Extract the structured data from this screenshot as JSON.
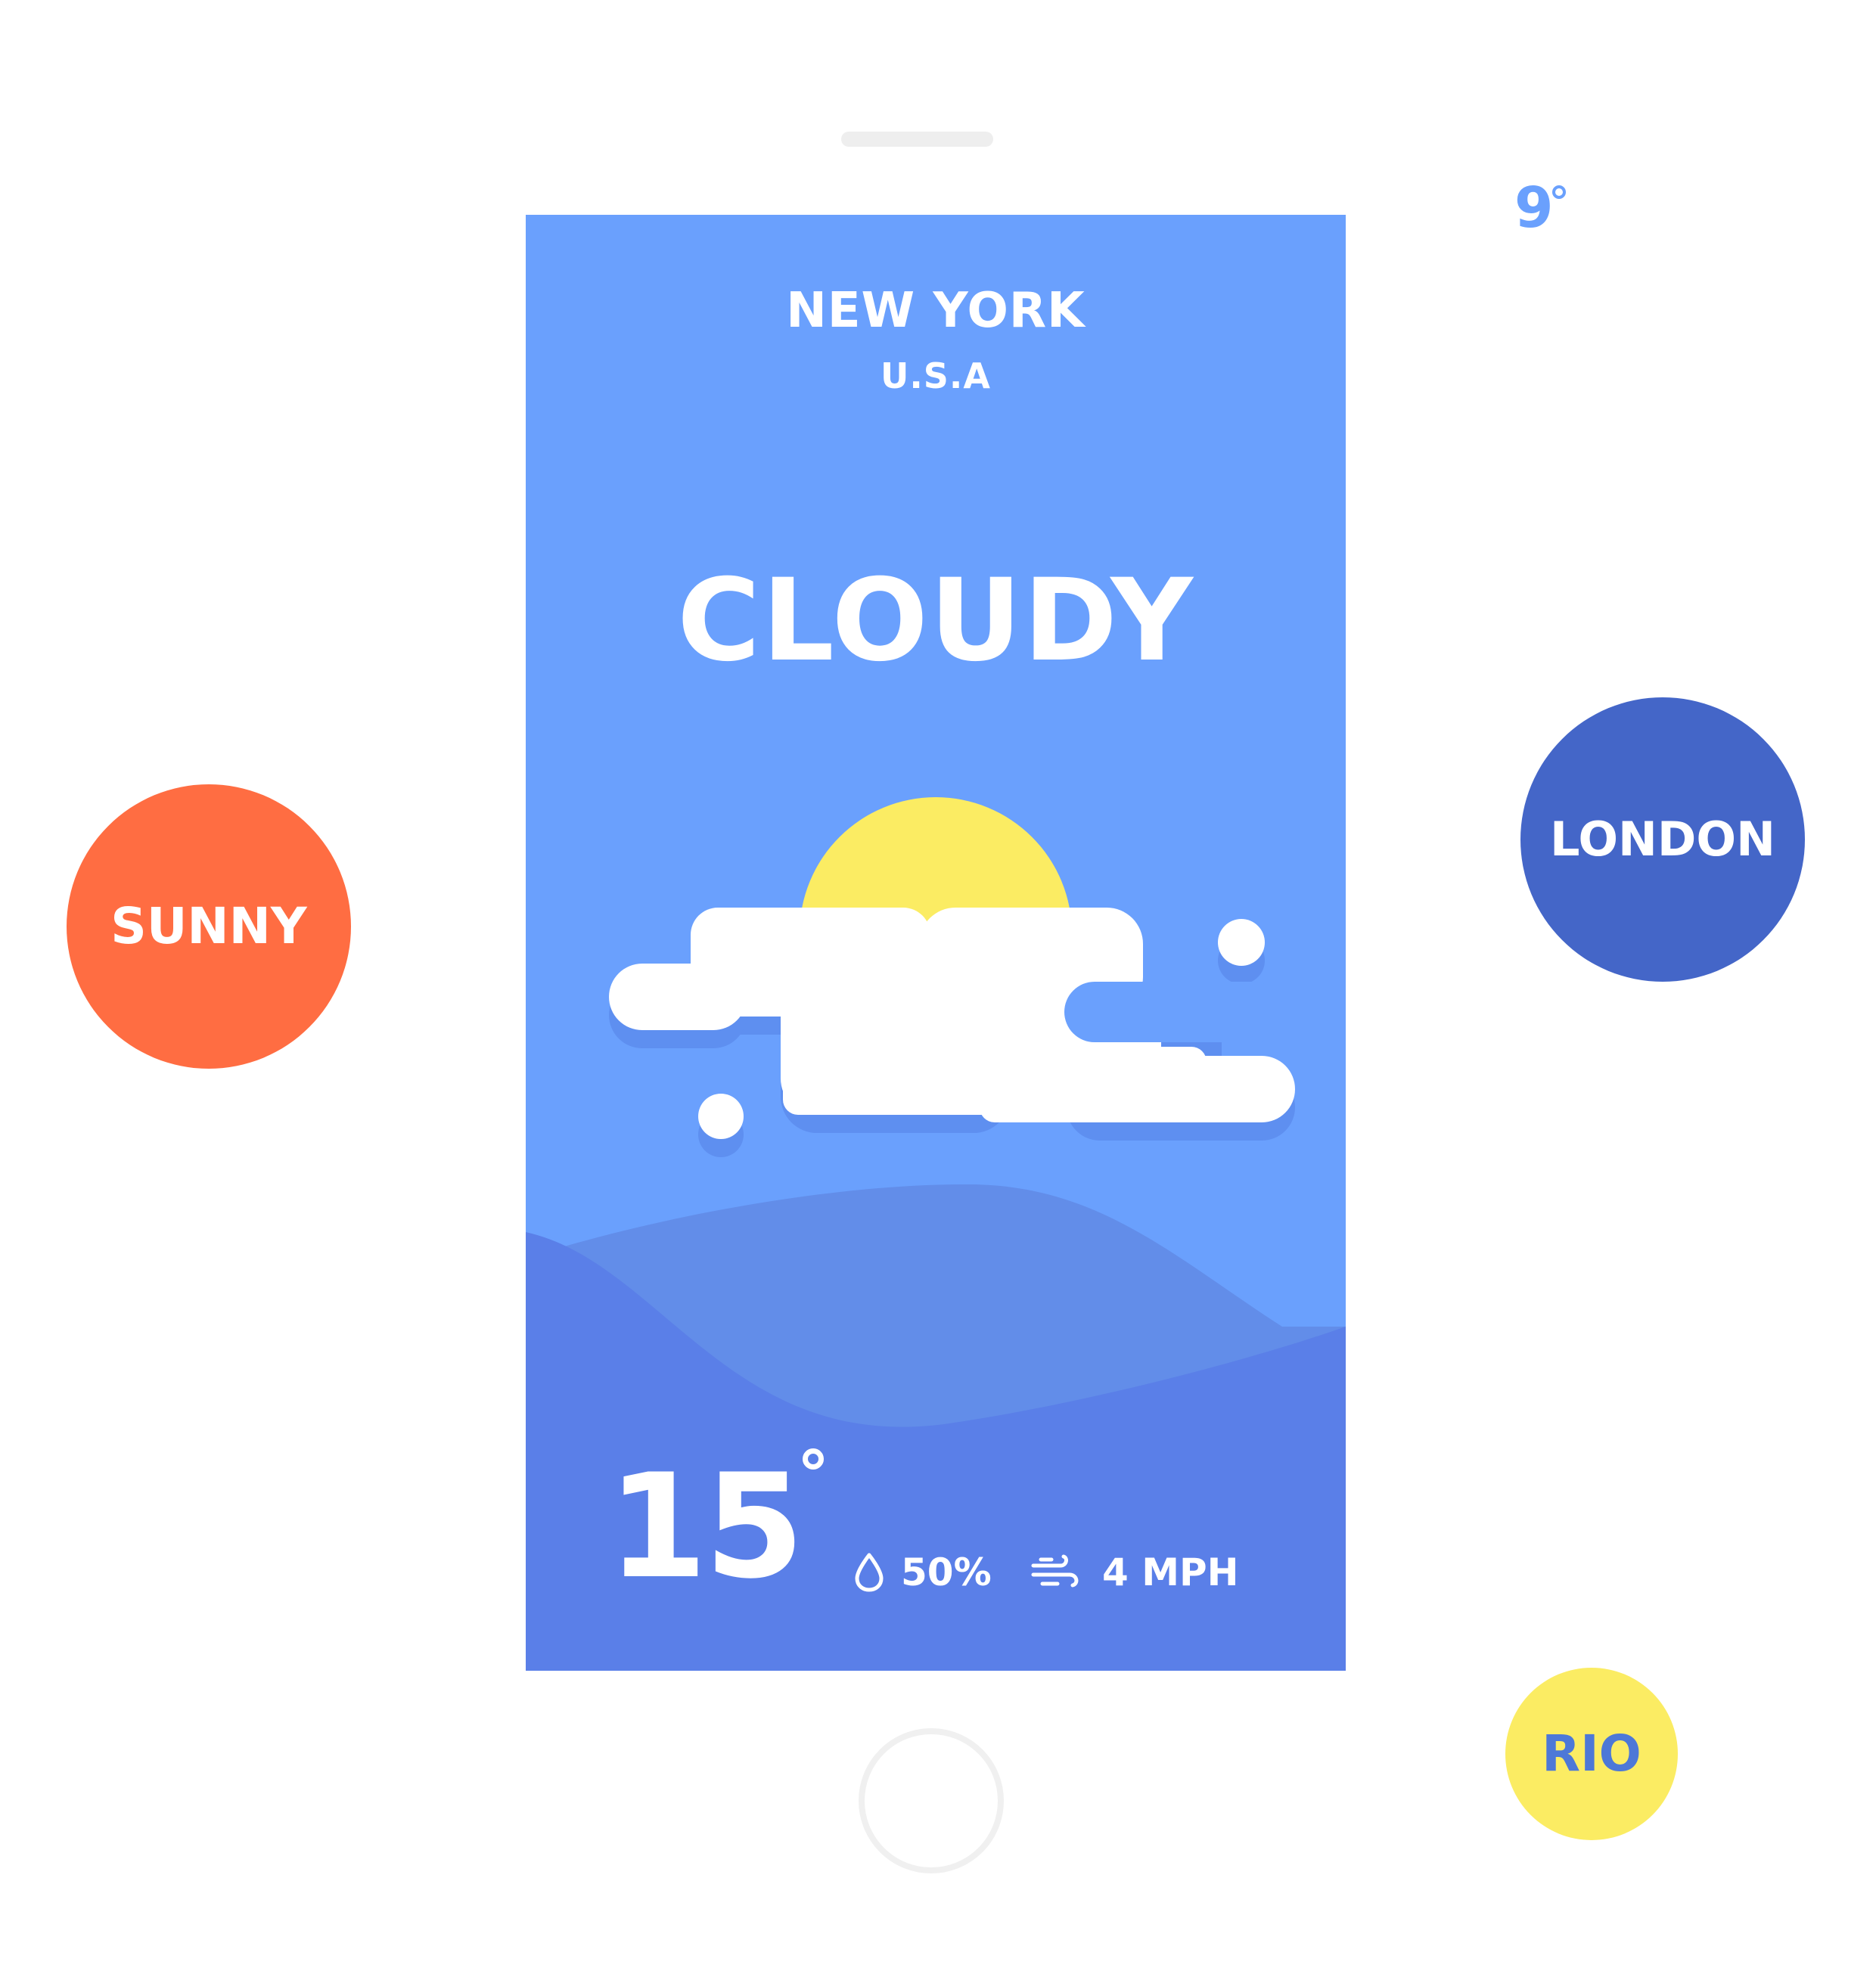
{
  "app": {
    "city": "NEW YORK",
    "country": "U.S.A",
    "condition": "CLOUDY",
    "condition_icon": "cloud-sun-icon"
  },
  "stats": {
    "temperature": "15",
    "temperature_unit": "°",
    "humidity": "50%",
    "humidity_icon": "droplet-icon",
    "wind": "4 MPH",
    "wind_icon": "wind-icon"
  },
  "other_cities": [
    {
      "label": "SUNNY",
      "color": "#ff6d42"
    },
    {
      "label": "LONDON",
      "color": "#4466c8"
    },
    {
      "label": "RIO",
      "color": "#fbec63"
    }
  ],
  "side_temperature": {
    "value": "9",
    "unit": "°"
  },
  "colors": {
    "screen_background": "#6aa0fd",
    "hill_back": "#628de9",
    "hill_front": "#5a7fe8",
    "sun": "#fbec63",
    "cloud": "#ffffff",
    "cloud_shadow": "#5e8ff0"
  }
}
